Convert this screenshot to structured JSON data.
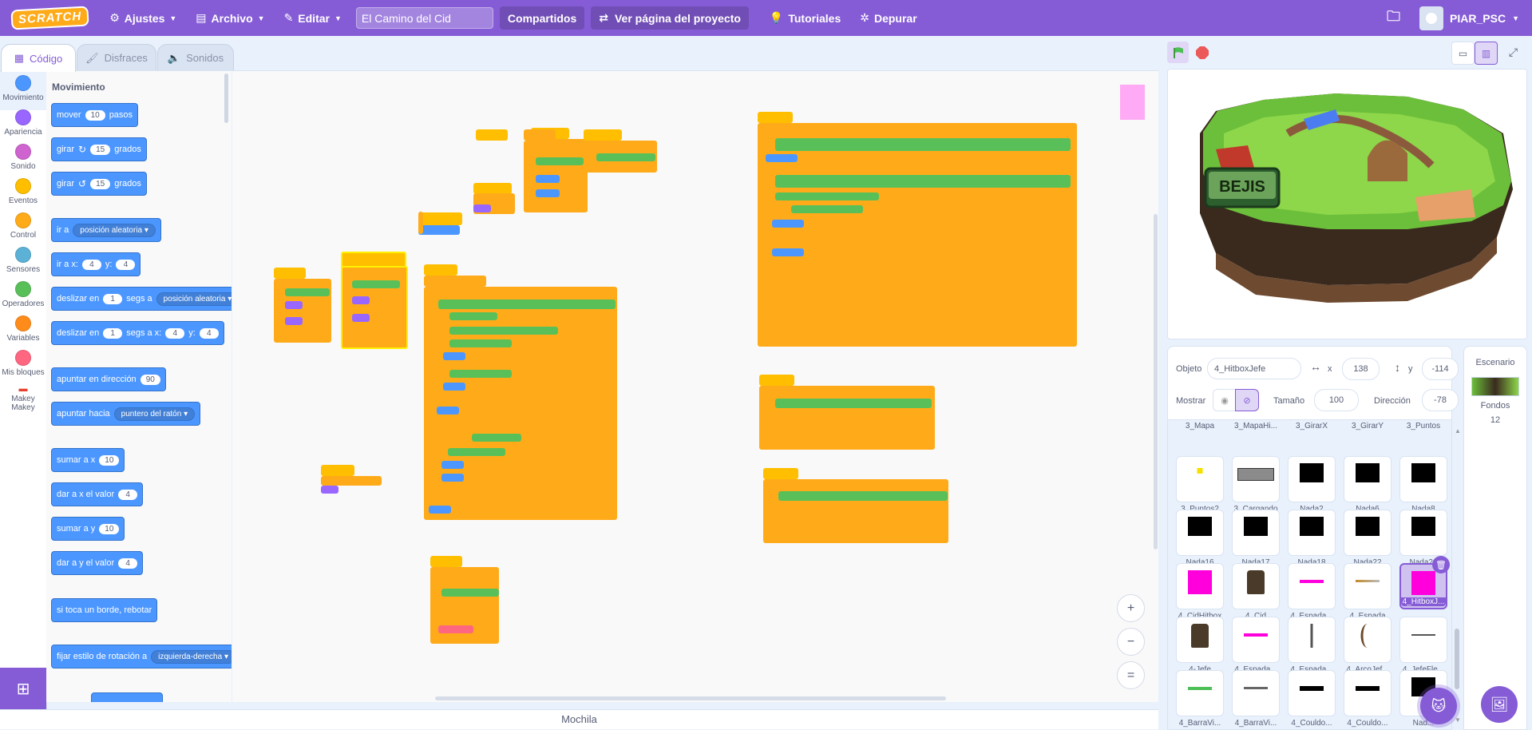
{
  "menubar": {
    "logo": "SCRATCH",
    "settings": "Ajustes",
    "file": "Archivo",
    "edit": "Editar",
    "project_title": "El Camino del Cid",
    "shared": "Compartidos",
    "view_project": "Ver página del proyecto",
    "tutorials": "Tutoriales",
    "debug": "Depurar",
    "username": "PIAR_PSC"
  },
  "tabs": {
    "code": "Código",
    "costumes": "Disfraces",
    "sounds": "Sonidos"
  },
  "categories": [
    {
      "label": "Movimiento",
      "color": "#4c97ff"
    },
    {
      "label": "Apariencia",
      "color": "#9966ff"
    },
    {
      "label": "Sonido",
      "color": "#cf63cf"
    },
    {
      "label": "Eventos",
      "color": "#ffbf00"
    },
    {
      "label": "Control",
      "color": "#ffab19"
    },
    {
      "label": "Sensores",
      "color": "#5cb1d6"
    },
    {
      "label": "Operadores",
      "color": "#59c059"
    },
    {
      "label": "Variables",
      "color": "#ff8c1a"
    },
    {
      "label": "Mis bloques",
      "color": "#ff6680"
    },
    {
      "label": "Makey Makey",
      "color": "#ffffff"
    }
  ],
  "palette": {
    "heading": "Movimiento",
    "move": {
      "a": "mover",
      "n": "10",
      "b": "pasos"
    },
    "turn_right": {
      "a": "girar",
      "n": "15",
      "b": "grados"
    },
    "turn_left": {
      "a": "girar",
      "n": "15",
      "b": "grados"
    },
    "goto": {
      "a": "ir a",
      "drop": "posición aleatoria"
    },
    "goto_xy": {
      "a": "ir a x:",
      "x": "4",
      "b": "y:",
      "y": "4"
    },
    "glide_to": {
      "a": "deslizar en",
      "n": "1",
      "b": "segs a",
      "drop": "posición aleatoria"
    },
    "glide_xy": {
      "a": "deslizar en",
      "n": "1",
      "b": "segs a x:",
      "x": "4",
      "c": "y:",
      "y": "4"
    },
    "point_dir": {
      "a": "apuntar en dirección",
      "n": "90"
    },
    "point_towards": {
      "a": "apuntar hacia",
      "drop": "puntero del ratón"
    },
    "change_x": {
      "a": "sumar a x",
      "n": "10"
    },
    "set_x": {
      "a": "dar a x el valor",
      "n": "4"
    },
    "change_y": {
      "a": "sumar a y",
      "n": "10"
    },
    "set_y": {
      "a": "dar a y el valor",
      "n": "4"
    },
    "bounce": {
      "a": "si toca un borde, rebotar"
    },
    "rotation": {
      "a": "fijar estilo de rotación a",
      "drop": "izquierda-derecha"
    }
  },
  "workspace": {
    "zoom_in": "+",
    "zoom_out": "−",
    "zoom_reset": "="
  },
  "backpack": "Mochila",
  "sprite_info": {
    "object_label": "Objeto",
    "object_name": "4_HitboxJefe",
    "x_label": "x",
    "x_value": "138",
    "y_label": "y",
    "y_value": "-114",
    "show_label": "Mostrar",
    "size_label": "Tamaño",
    "size_value": "100",
    "direction_label": "Dirección",
    "direction_value": "-78"
  },
  "sprites": [
    {
      "name": "3_Mapa",
      "thumb": "none"
    },
    {
      "name": "3_MapaHi...",
      "thumb": "none"
    },
    {
      "name": "3_GirarX",
      "thumb": "none"
    },
    {
      "name": "3_GirarY",
      "thumb": "none"
    },
    {
      "name": "3_Puntos",
      "thumb": "none"
    },
    {
      "name": "3_Puntos2",
      "thumb": "dot"
    },
    {
      "name": "3_Cargando",
      "thumb": "card"
    },
    {
      "name": "Nada2",
      "thumb": "black"
    },
    {
      "name": "Nada6",
      "thumb": "black"
    },
    {
      "name": "Nada8",
      "thumb": "black"
    },
    {
      "name": "Nada16",
      "thumb": "black"
    },
    {
      "name": "Nada17",
      "thumb": "black"
    },
    {
      "name": "Nada18",
      "thumb": "black"
    },
    {
      "name": "Nada22",
      "thumb": "black"
    },
    {
      "name": "Nada23",
      "thumb": "black"
    },
    {
      "name": "4_CidHitbox",
      "thumb": "magenta"
    },
    {
      "name": "4_Cid",
      "thumb": "char"
    },
    {
      "name": "4_Espada...",
      "thumb": "bar-magenta"
    },
    {
      "name": "4_Espada",
      "thumb": "sword"
    },
    {
      "name": "4_HitboxJ...",
      "thumb": "magenta"
    },
    {
      "name": "4-Jefe",
      "thumb": "char"
    },
    {
      "name": "4_Espada...",
      "thumb": "bar-magenta"
    },
    {
      "name": "4_Espada...",
      "thumb": "vsword"
    },
    {
      "name": "4_ArcoJef...",
      "thumb": "bow"
    },
    {
      "name": "4_JefeFle...",
      "thumb": "arrow"
    },
    {
      "name": "4_BarraVi...",
      "thumb": "bar-green"
    },
    {
      "name": "4_BarraVi...",
      "thumb": "bar-gray"
    },
    {
      "name": "4_Couldo...",
      "thumb": "bar-black"
    },
    {
      "name": "4_Couldo...",
      "thumb": "bar-black"
    },
    {
      "name": "Nad...",
      "thumb": "black"
    }
  ],
  "stage_pane": {
    "title": "Escenario",
    "backdrops_label": "Fondos",
    "backdrops_count": "12"
  },
  "stage_sign": "BEJIS",
  "colors": {
    "menubar": "#855cd6",
    "motion": "#4c97ff",
    "control": "#ffab19",
    "operators": "#59c059",
    "selected_sprite": "#855cd6"
  }
}
